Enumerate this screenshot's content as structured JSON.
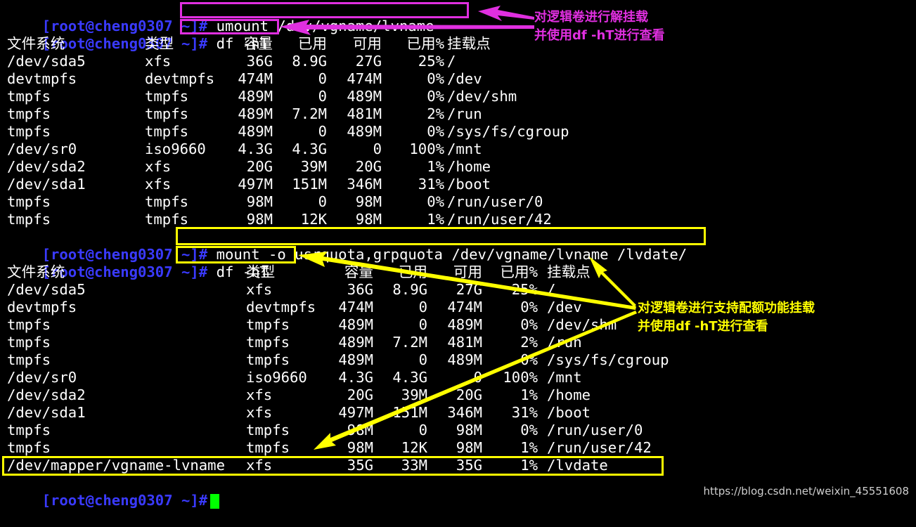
{
  "prompt": "[root@cheng0307 ~]#",
  "commands": {
    "umount": "umount /dev/vgname/lvname",
    "df1": "df -hT",
    "mount": "mount -o usrquota,grpquota /dev/vgname/lvname /lvdate/",
    "df2": "df -hT"
  },
  "table1": {
    "headers": [
      "文件系统",
      "类型",
      "容量",
      "已用",
      "可用",
      "已用%",
      "挂载点"
    ],
    "rows": [
      [
        "/dev/sda5",
        "xfs",
        "36G",
        "8.9G",
        "27G",
        "25%",
        "/"
      ],
      [
        "devtmpfs",
        "devtmpfs",
        "474M",
        "0",
        "474M",
        "0%",
        "/dev"
      ],
      [
        "tmpfs",
        "tmpfs",
        "489M",
        "0",
        "489M",
        "0%",
        "/dev/shm"
      ],
      [
        "tmpfs",
        "tmpfs",
        "489M",
        "7.2M",
        "481M",
        "2%",
        "/run"
      ],
      [
        "tmpfs",
        "tmpfs",
        "489M",
        "0",
        "489M",
        "0%",
        "/sys/fs/cgroup"
      ],
      [
        "/dev/sr0",
        "iso9660",
        "4.3G",
        "4.3G",
        "0",
        "100%",
        "/mnt"
      ],
      [
        "/dev/sda2",
        "xfs",
        "20G",
        "39M",
        "20G",
        "1%",
        "/home"
      ],
      [
        "/dev/sda1",
        "xfs",
        "497M",
        "151M",
        "346M",
        "31%",
        "/boot"
      ],
      [
        "tmpfs",
        "tmpfs",
        "98M",
        "0",
        "98M",
        "0%",
        "/run/user/0"
      ],
      [
        "tmpfs",
        "tmpfs",
        "98M",
        "12K",
        "98M",
        "1%",
        "/run/user/42"
      ]
    ]
  },
  "table2": {
    "headers": [
      "文件系统",
      "类型",
      "容量",
      "已用",
      "可用",
      "已用%",
      "挂载点"
    ],
    "rows": [
      [
        "/dev/sda5",
        "xfs",
        "36G",
        "8.9G",
        "27G",
        "25%",
        "/"
      ],
      [
        "devtmpfs",
        "devtmpfs",
        "474M",
        "0",
        "474M",
        "0%",
        "/dev"
      ],
      [
        "tmpfs",
        "tmpfs",
        "489M",
        "0",
        "489M",
        "0%",
        "/dev/shm"
      ],
      [
        "tmpfs",
        "tmpfs",
        "489M",
        "7.2M",
        "481M",
        "2%",
        "/run"
      ],
      [
        "tmpfs",
        "tmpfs",
        "489M",
        "0",
        "489M",
        "0%",
        "/sys/fs/cgroup"
      ],
      [
        "/dev/sr0",
        "iso9660",
        "4.3G",
        "4.3G",
        "0",
        "100%",
        "/mnt"
      ],
      [
        "/dev/sda2",
        "xfs",
        "20G",
        "39M",
        "20G",
        "1%",
        "/home"
      ],
      [
        "/dev/sda1",
        "xfs",
        "497M",
        "151M",
        "346M",
        "31%",
        "/boot"
      ],
      [
        "tmpfs",
        "tmpfs",
        "98M",
        "0",
        "98M",
        "0%",
        "/run/user/0"
      ],
      [
        "tmpfs",
        "tmpfs",
        "98M",
        "12K",
        "98M",
        "1%",
        "/run/user/42"
      ],
      [
        "/dev/mapper/vgname-lvname",
        "xfs",
        "35G",
        "33M",
        "35G",
        "1%",
        "/lvdate"
      ]
    ]
  },
  "annotations": {
    "magenta": "对逻辑卷进行解挂载\n并使用df -hT进行查看",
    "yellow": "对逻辑卷进行支持配额功能挂载\n并使用df -hT进行查看"
  },
  "colors": {
    "prompt": "#3a3aff",
    "magenta": "#e02fe0",
    "yellow": "#ffff00",
    "cursor": "#00ff00"
  },
  "watermark": "https://blog.csdn.net/weixin_45551608"
}
